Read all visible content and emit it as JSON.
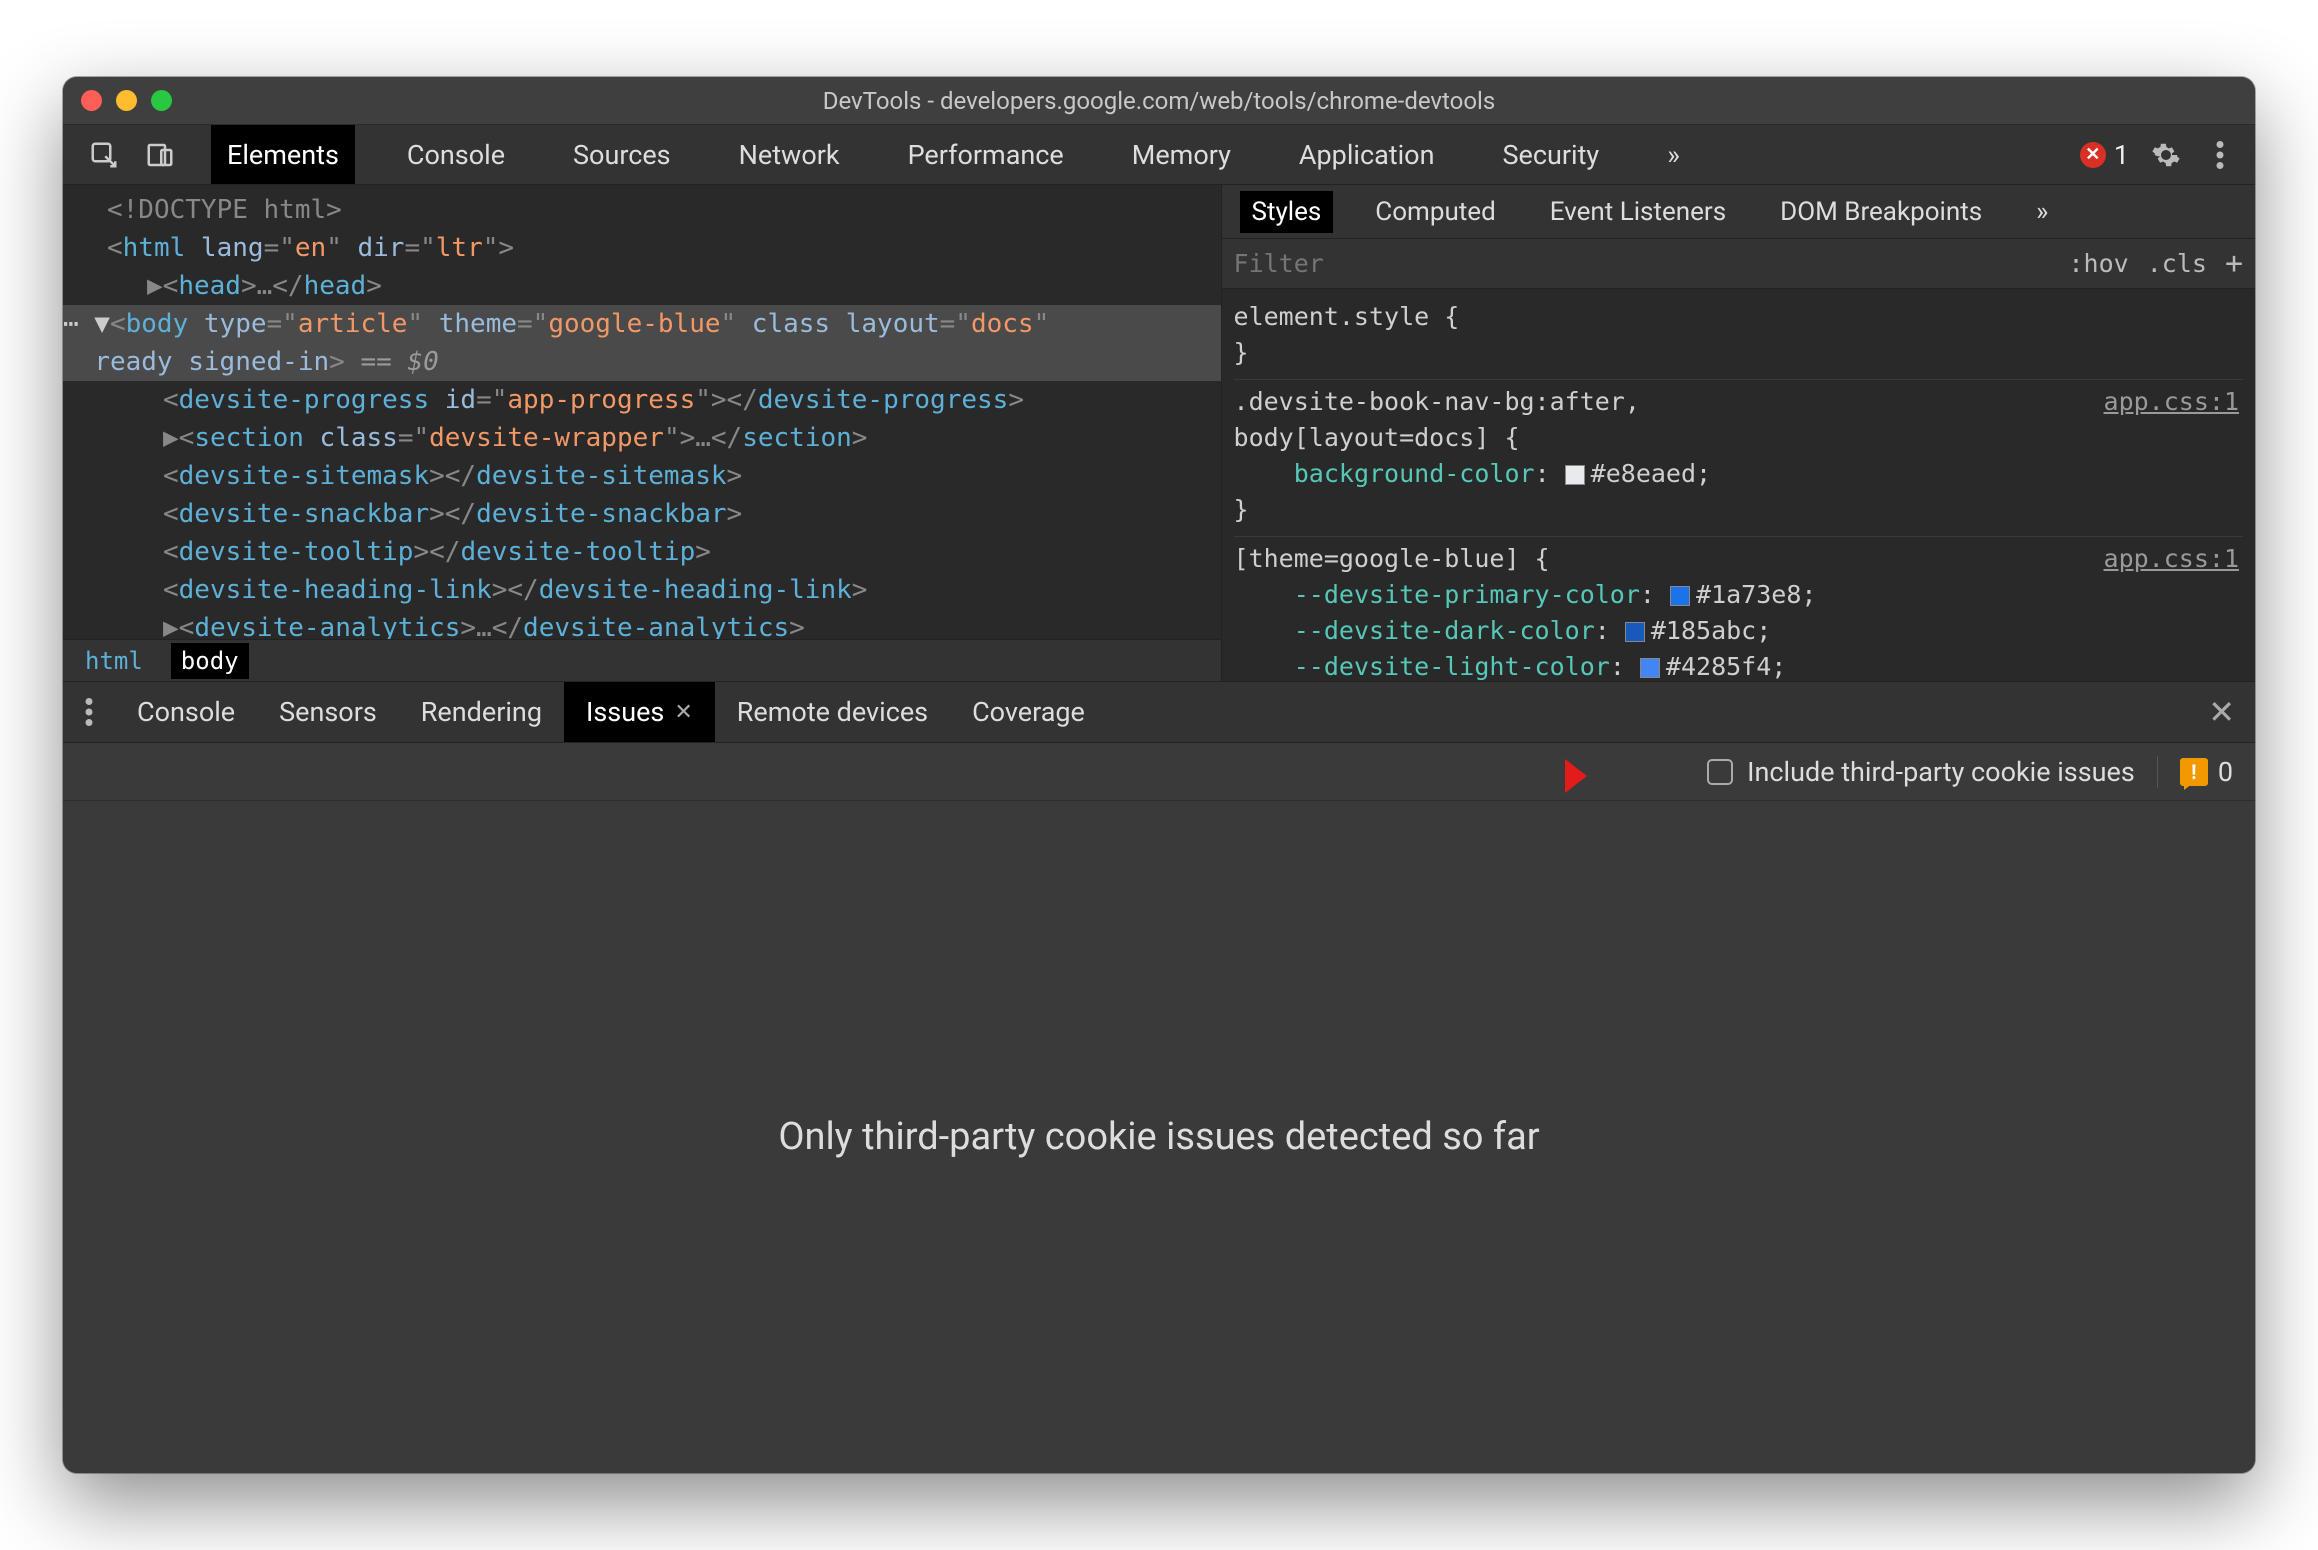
{
  "window": {
    "title": "DevTools - developers.google.com/web/tools/chrome-devtools"
  },
  "topTabs": {
    "items": [
      "Elements",
      "Console",
      "Sources",
      "Network",
      "Performance",
      "Memory",
      "Application",
      "Security"
    ],
    "overflow": "»",
    "active": "Elements"
  },
  "errors": {
    "count": "1"
  },
  "dom": {
    "line0": "<!DOCTYPE html>",
    "html_open": "<",
    "html_tag": "html",
    "html_attrs": " lang=\"en\" dir=\"ltr\"",
    "html_close": ">",
    "head": "<head>…</head>",
    "body_open1": "<body type=\"article\" theme=\"google-blue\" class layout=\"docs\"",
    "body_open2": "ready signed-in>",
    "eq0": " == $0",
    "child1": "<devsite-progress id=\"app-progress\"></devsite-progress>",
    "child2": "<section class=\"devsite-wrapper\">…</section>",
    "child3": "<devsite-sitemask></devsite-sitemask>",
    "child4": "<devsite-snackbar></devsite-snackbar>",
    "child5": "<devsite-tooltip></devsite-tooltip>",
    "child6": "<devsite-heading-link></devsite-heading-link>",
    "child7": "<devsite-analytics>…</devsite-analytics>"
  },
  "breadcrumb": {
    "items": [
      "html",
      "body"
    ],
    "active": "body"
  },
  "stylesTabs": {
    "items": [
      "Styles",
      "Computed",
      "Event Listeners",
      "DOM Breakpoints"
    ],
    "overflow": "»",
    "active": "Styles"
  },
  "stylesFilter": {
    "placeholder": "Filter",
    "hov": ":hov",
    "cls": ".cls",
    "plus": "+"
  },
  "styles": {
    "rule0": {
      "selector": "element.style {",
      "close": "}"
    },
    "rule1": {
      "selector": ".devsite-book-nav-bg:after,\nbody[layout=docs] {",
      "prop": "background-color",
      "val": "#e8eaed",
      "swatch": "#e8eaed",
      "close": "}",
      "source": "app.css:1"
    },
    "rule2": {
      "selector": "[theme=google-blue] {",
      "source": "app.css:1",
      "p1": "--devsite-primary-color",
      "v1": "#1a73e8",
      "s1": "#1a73e8",
      "p2": "--devsite-dark-color",
      "v2": "#185abc",
      "s2": "#185abc",
      "p3": "--devsite-light-color",
      "v3": "#4285f4",
      "s3": "#4285f4"
    }
  },
  "drawer": {
    "tabs": [
      "Console",
      "Sensors",
      "Rendering",
      "Issues",
      "Remote devices",
      "Coverage"
    ],
    "active": "Issues"
  },
  "issues": {
    "includeThirdParty": "Include third-party cookie issues",
    "count": "0",
    "message": "Only third-party cookie issues detected so far"
  }
}
